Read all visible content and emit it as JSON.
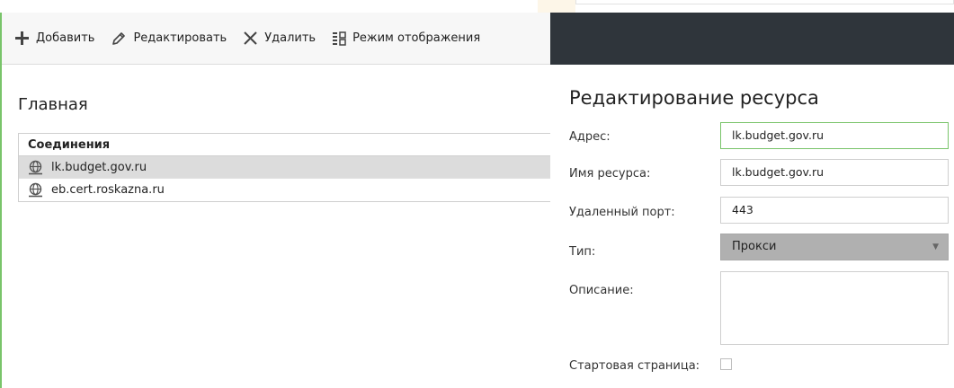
{
  "toolbar": {
    "add_label": "Добавить",
    "edit_label": "Редактировать",
    "delete_label": "Удалить",
    "view_mode_label": "Режим отображения"
  },
  "main": {
    "title": "Главная",
    "connections_header": "Соединения",
    "connections": [
      {
        "name": "lk.budget.gov.ru",
        "selected": true
      },
      {
        "name": "eb.cert.roskazna.ru",
        "selected": false
      }
    ]
  },
  "editor": {
    "title": "Редактирование ресурса",
    "address_label": "Адрес:",
    "address_value": "lk.budget.gov.ru",
    "resource_name_label": "Имя ресурса:",
    "resource_name_value": "lk.budget.gov.ru",
    "remote_port_label": "Удаленный порт:",
    "remote_port_value": "443",
    "type_label": "Тип:",
    "type_value": "Прокси",
    "description_label": "Описание:",
    "start_page_label": "Стартовая страница:",
    "start_page_checked": false
  },
  "colors": {
    "accent_green": "#79c46a",
    "dark_header": "#2f353b",
    "selected_row": "#dcdcdc",
    "select_bg": "#b0b0b0"
  },
  "icons": {
    "add": "plus-icon",
    "edit": "pencil-icon",
    "delete": "close-icon",
    "view_mode": "grid-view-icon",
    "connection": "globe-icon",
    "dropdown": "caret-down-icon"
  }
}
